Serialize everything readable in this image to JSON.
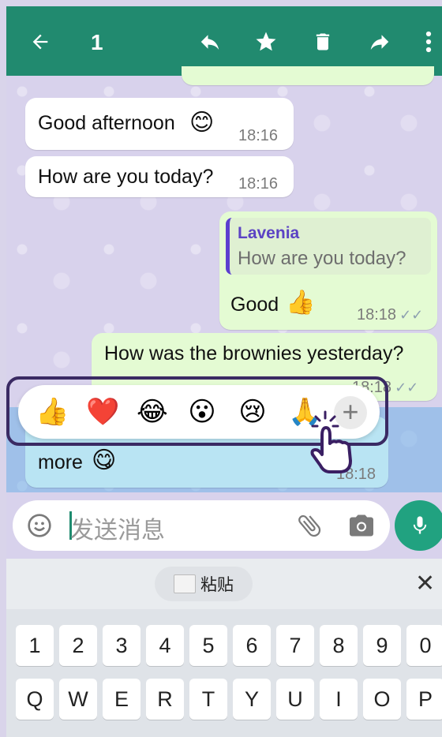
{
  "header": {
    "selected_count": "1",
    "icons": [
      "back-arrow-icon",
      "reply-icon",
      "star-icon",
      "trash-icon",
      "forward-icon",
      "more-vert-icon"
    ],
    "color": "#218a6f"
  },
  "messages": [
    {
      "direction": "in",
      "text": "Good afternoon",
      "emoji": "😊",
      "time": "18:16"
    },
    {
      "direction": "in",
      "text": "How are you today?",
      "time": "18:16"
    },
    {
      "direction": "out",
      "reply_to_name": "Lavenia",
      "reply_to_text": "How are you today?",
      "text": "Good",
      "emoji": "👍",
      "time": "18:18"
    },
    {
      "direction": "out",
      "text": "How was the brownies yesterday?",
      "time": "18:18"
    },
    {
      "direction": "in",
      "text_fragment": "more",
      "emoji": "😋",
      "time": "18:18",
      "selected": true
    }
  ],
  "reactions": [
    "👍",
    "❤️",
    "😂",
    "😮",
    "😢",
    "🙏"
  ],
  "reaction_more_label": "+",
  "composer": {
    "placeholder": "发送消息",
    "icons": [
      "emoji-icon",
      "attach-icon",
      "camera-icon",
      "mic-icon"
    ]
  },
  "keyboard": {
    "paste_label": "粘贴",
    "close_label": "✕",
    "row_numbers": [
      "1",
      "2",
      "3",
      "4",
      "5",
      "6",
      "7",
      "8",
      "9",
      "0"
    ],
    "row_letters": [
      "Q",
      "W",
      "E",
      "R",
      "T",
      "Y",
      "U",
      "I",
      "O",
      "P"
    ]
  }
}
